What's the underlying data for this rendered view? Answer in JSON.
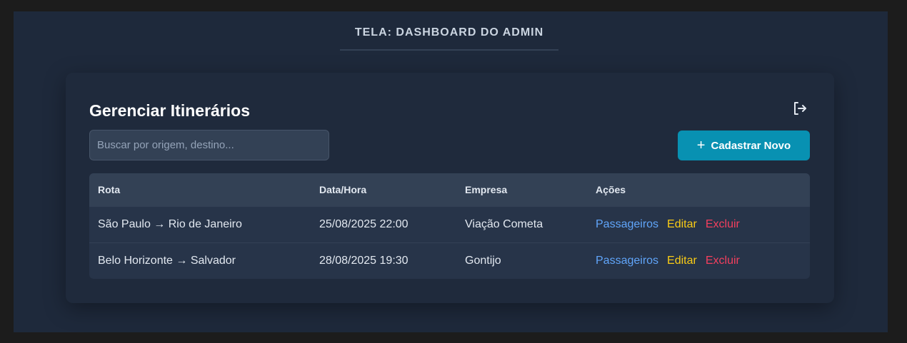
{
  "screen_title": "TELA: DASHBOARD DO ADMIN",
  "card": {
    "title": "Gerenciar Itinerários",
    "logout_icon": "logout-icon"
  },
  "search": {
    "placeholder": "Buscar por origem, destino...",
    "value": ""
  },
  "new_button": {
    "icon": "+",
    "label": "Cadastrar Novo"
  },
  "table": {
    "columns": [
      "Rota",
      "Data/Hora",
      "Empresa",
      "Ações"
    ],
    "rows": [
      {
        "rota": "São Paulo → Rio de Janeiro",
        "data_hora": "25/08/2025 22:00",
        "empresa": "Viação Cometa",
        "acoes": [
          "Passageiros",
          "Editar",
          "Excluir"
        ]
      },
      {
        "rota": "Belo Horizonte → Salvador",
        "data_hora": "28/08/2025 19:30",
        "empresa": "Gontijo",
        "acoes": [
          "Passageiros",
          "Editar",
          "Excluir"
        ]
      }
    ]
  },
  "colors": {
    "accent": "#0891b2",
    "link_passageiros": "#60a5fa",
    "link_editar": "#facc15",
    "link_excluir": "#f43f5e"
  }
}
